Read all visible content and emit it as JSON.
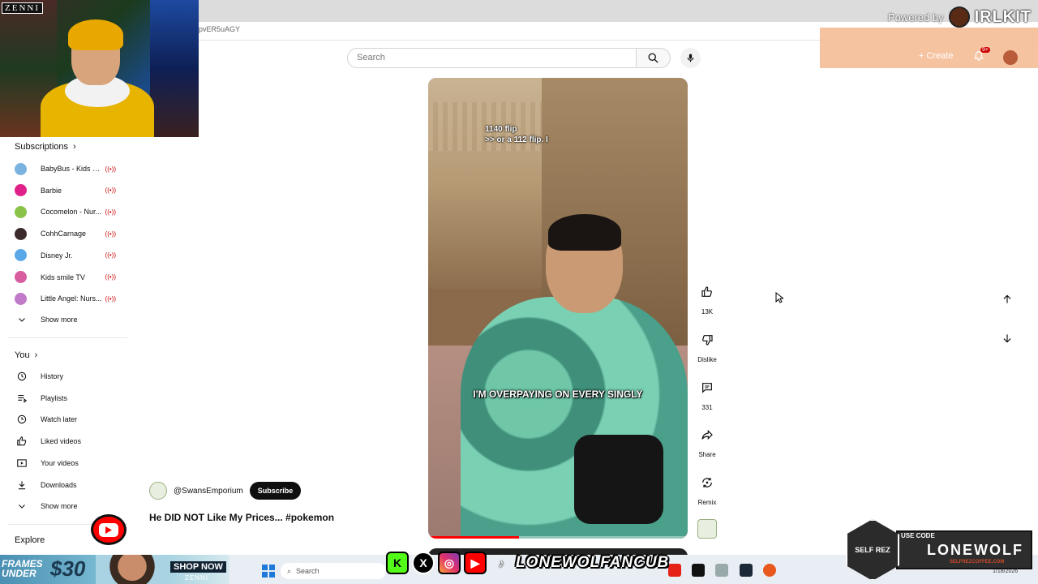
{
  "browser": {
    "url_fragment": "pvER5uAGY",
    "powered_by": "Powered by",
    "powered_logo": "IRLKIT"
  },
  "webcam": {
    "brand": "ZENNI"
  },
  "header": {
    "search_placeholder": "Search",
    "create_label": "Create",
    "notification_count": "9+"
  },
  "sidebar": {
    "subscriptions_title": "Subscriptions",
    "subscriptions": [
      {
        "name": "BabyBus - Kids S...",
        "color": "#7bb3e0"
      },
      {
        "name": "Barbie",
        "color": "#e0218a"
      },
      {
        "name": "Cocomelon - Nur...",
        "color": "#8bc34a"
      },
      {
        "name": "CohhCarnage",
        "color": "#3a2a2a"
      },
      {
        "name": "Disney Jr.",
        "color": "#5aa8e8"
      },
      {
        "name": "Kids smile TV",
        "color": "#d85ca0"
      },
      {
        "name": "Little Angel: Nurs...",
        "color": "#c07ac8"
      }
    ],
    "show_more": "Show more",
    "you_title": "You",
    "you_items": [
      {
        "label": "History",
        "icon": "history-icon"
      },
      {
        "label": "Playlists",
        "icon": "playlists-icon"
      },
      {
        "label": "Watch later",
        "icon": "watch-later-icon"
      },
      {
        "label": "Liked videos",
        "icon": "liked-videos-icon"
      },
      {
        "label": "Your videos",
        "icon": "your-videos-icon"
      },
      {
        "label": "Downloads",
        "icon": "downloads-icon"
      }
    ],
    "show_more_2": "Show more",
    "explore_title": "Explore"
  },
  "short": {
    "caption_top_1": "1140 flip",
    "caption_top_2": ">> or a 112 flip. I",
    "caption_main": "I'M OVERPAYING ON EVERY SINGLY",
    "progress": 0.35,
    "channel": "@SwansEmporium",
    "subscribe": "Subscribe",
    "title": "He DID NOT Like My Prices... #pokemon"
  },
  "actions": {
    "like_count": "13K",
    "dislike": "Dislike",
    "comments_count": "331",
    "share": "Share",
    "remix": "Remix"
  },
  "overlays": {
    "ad_frames_line1": "FRAMES",
    "ad_frames_line2": "UNDER",
    "ad_price": "$30",
    "ad_shop": "SHOP NOW",
    "ad_brand": "ZENNI",
    "social_handle": "LONEWOLFANCUB",
    "coffee_brand": "SELF REZ",
    "coffee_code_label": "USE CODE",
    "coffee_code": "LONEWOLF",
    "coffee_url": "SELFREZCOFFEE.COM"
  },
  "taskbar": {
    "search": "Search",
    "date": "1/18/2026"
  }
}
